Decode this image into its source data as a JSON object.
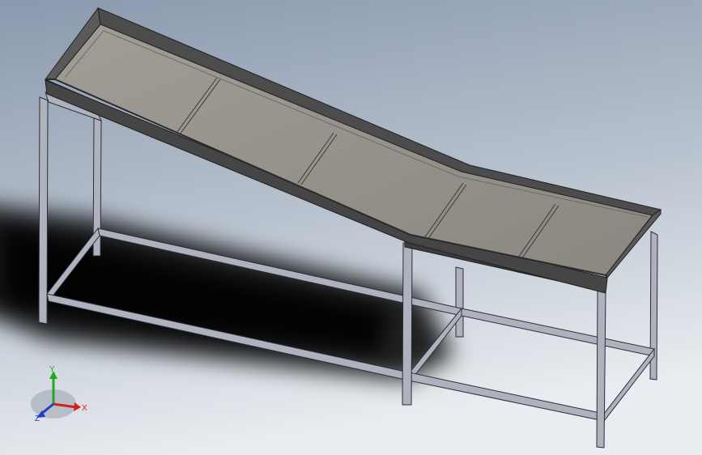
{
  "viewport": {
    "background_top": "#8c9bb0",
    "background_bottom": "#e6eaee",
    "shadow_color": "#000000"
  },
  "model": {
    "name": "inclined-conveyor-table",
    "tray_surface_color": "#8d8a85",
    "tray_rim_color": "#4a4a4a",
    "frame_color": "#aeb2bf",
    "frame_edge_color": "#2d2d33"
  },
  "triad": {
    "x_label": "X",
    "y_label": "Y",
    "z_label": "Z",
    "x_color": "#d22020",
    "y_color": "#28a428",
    "z_color": "#2040c8"
  }
}
